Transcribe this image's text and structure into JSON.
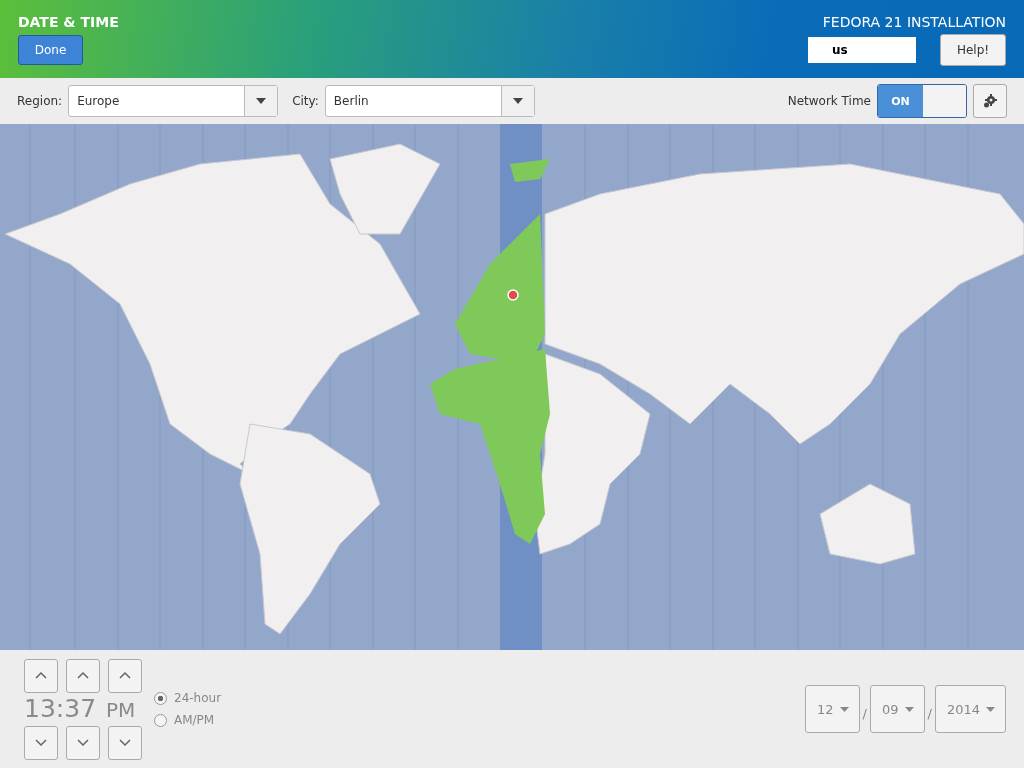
{
  "header": {
    "title": "DATE & TIME",
    "done_button": "Done",
    "product": "FEDORA 21 INSTALLATION",
    "keyboard_layout": "us",
    "help_button": "Help!"
  },
  "toolbar": {
    "region_label": "Region:",
    "region_value": "Europe",
    "city_label": "City:",
    "city_value": "Berlin",
    "network_time_label": "Network Time",
    "network_time_switch": "ON",
    "network_time_on": true
  },
  "time": {
    "hours": "13",
    "separator": ":",
    "minutes": "37",
    "period": "PM"
  },
  "time_format": [
    {
      "label": "24-hour",
      "selected": true
    },
    {
      "label": "AM/PM",
      "selected": false
    }
  ],
  "date": [
    {
      "value": "12"
    },
    {
      "value": "09"
    },
    {
      "value": "2014"
    }
  ],
  "date_separator": "/"
}
